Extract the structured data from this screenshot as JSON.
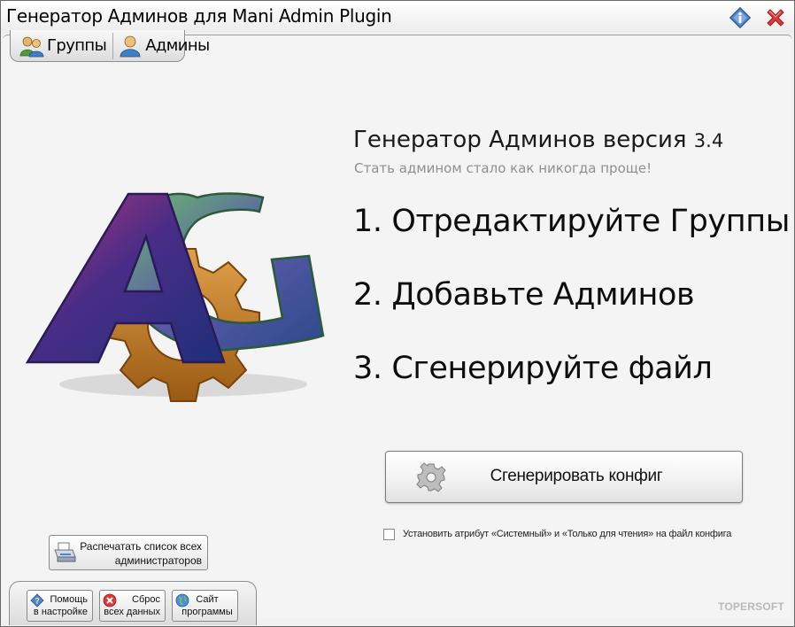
{
  "window": {
    "title": "Генератор Админов для Mani Admin Plugin",
    "info_icon": "info-icon",
    "close_icon": "close-icon"
  },
  "tabs": [
    {
      "label": "Группы",
      "icon": "users-group-icon"
    },
    {
      "label": "Админы",
      "icon": "user-icon"
    }
  ],
  "logo": {
    "letters": "AG",
    "icon": "gear-logo"
  },
  "main": {
    "title": "Генератор Админов версия",
    "version": "3.4",
    "subtitle": "Стать админом стало как никогда проще!",
    "steps": [
      "1. Отредактируйте Группы",
      "2. Добавьте Админов",
      "3. Сгенерируйте файл"
    ],
    "generate_button": "Сгенерировать конфиг",
    "checkbox_label": "Установить атрибут «Системный» и «Только для чтения» на файл конфига",
    "checkbox_checked": false
  },
  "print_button": {
    "line1": "Распечатать список всех",
    "line2": "администраторов",
    "icon": "printer-icon"
  },
  "bottom_buttons": [
    {
      "line1": "Помощь",
      "line2": "в настройке",
      "icon": "help-icon"
    },
    {
      "line1": "Сброс",
      "line2": "всех данных",
      "icon": "reset-icon"
    },
    {
      "line1": "Сайт",
      "line2": "программы",
      "icon": "globe-icon"
    }
  ],
  "brand": "TOPERSOFT",
  "colors": {
    "close": "#d93a3a",
    "info": "#3d6fbf",
    "gear": "#c47a1f",
    "letter_a": "#4a2a7a",
    "letter_g": "#3c7a4a"
  }
}
